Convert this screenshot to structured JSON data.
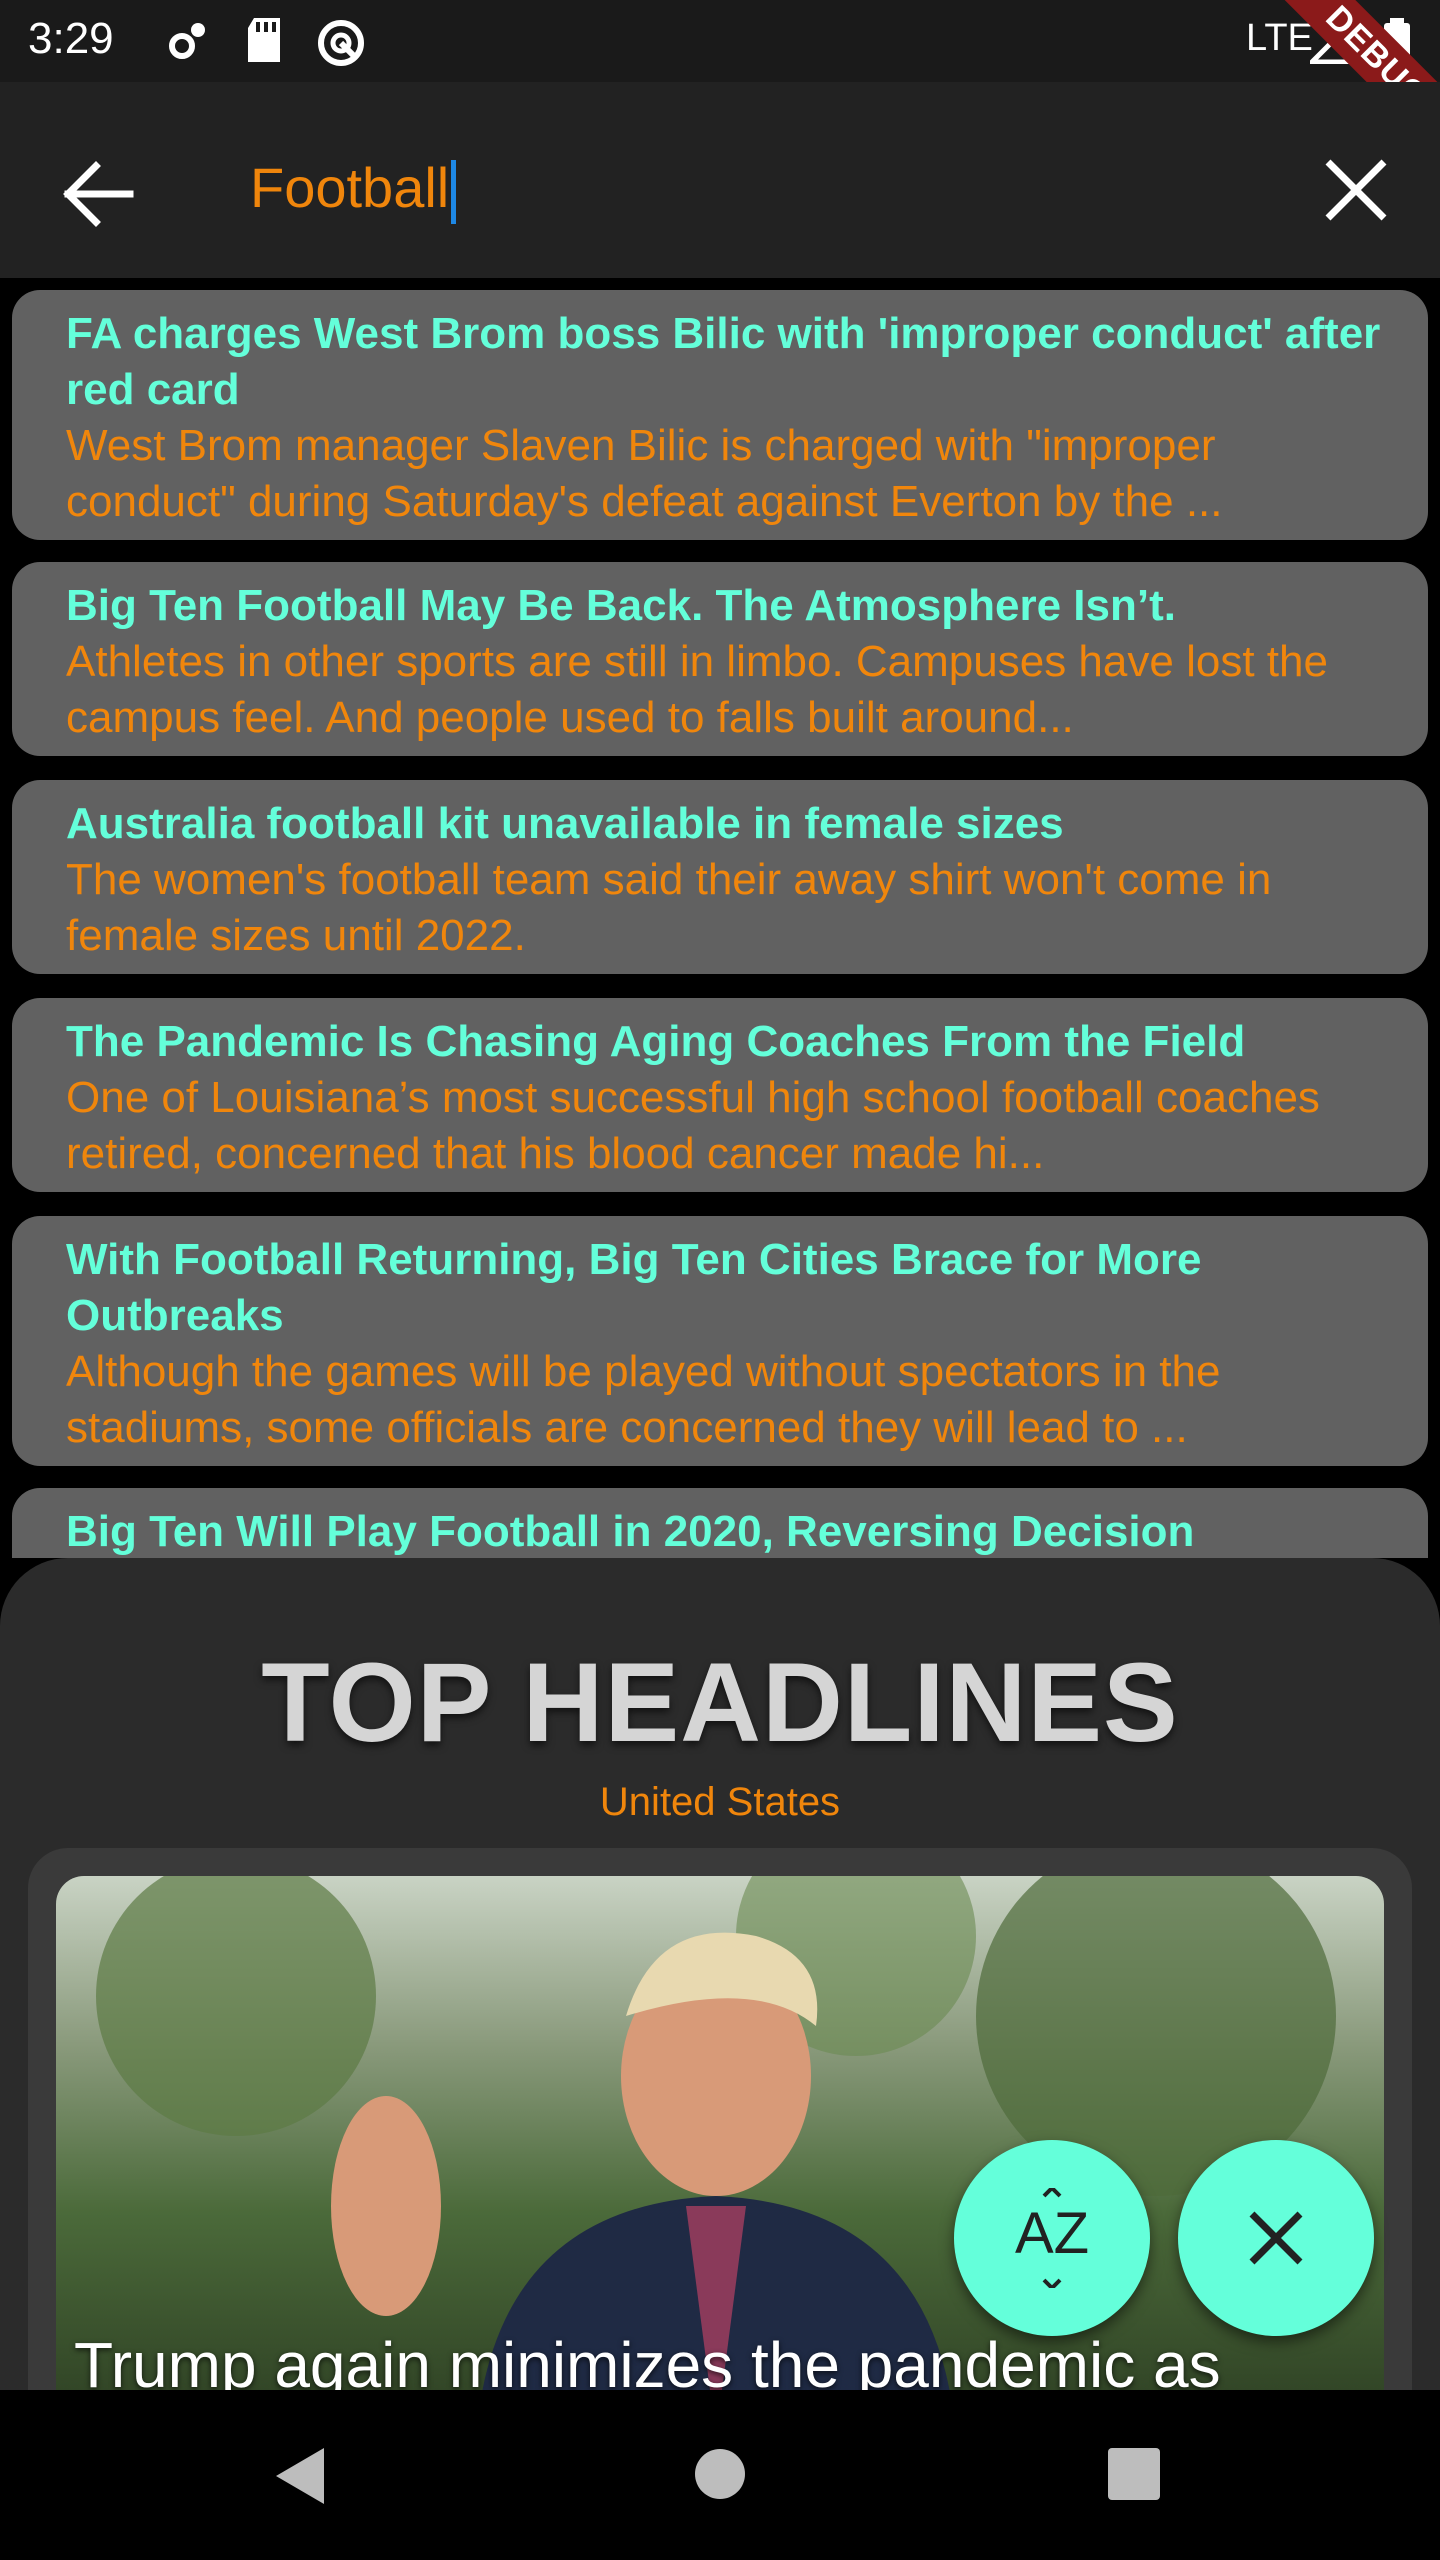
{
  "status_bar": {
    "time": "3:29",
    "network": "LTE",
    "debug_label": "DEBUG"
  },
  "search": {
    "query": "Football"
  },
  "results": [
    {
      "title": "FA charges West Brom boss Bilic with 'improper conduct' after red card",
      "description": "West Brom manager Slaven Bilic is charged with \"improper conduct\" during Saturday's defeat against Everton by the ..."
    },
    {
      "title": "Big Ten Football May Be Back. The Atmosphere Isn’t.",
      "description": "Athletes in other sports are still in limbo. Campuses have lost the campus feel. And people used to falls built around..."
    },
    {
      "title": "Australia football kit unavailable in female sizes",
      "description": "The women's football team said their away shirt won't come in female sizes until 2022."
    },
    {
      "title": "The Pandemic Is Chasing Aging Coaches From the Field",
      "description": "One of Louisiana’s most successful high school football coaches retired, concerned that his blood cancer made hi..."
    },
    {
      "title": "With Football Returning, Big Ten Cities Brace for More Outbreaks",
      "description": "Although the games will be played without spectators in the stadiums, some officials are concerned they will lead to ..."
    },
    {
      "title": "Big Ten Will Play Football in 2020, Reversing Decision",
      "description": ""
    }
  ],
  "top_headlines": {
    "title": "TOP HEADLINES",
    "country": "United States",
    "headline": "Trump again minimizes the pandemic as"
  },
  "fabs": {
    "sort_label": "AZ"
  },
  "colors": {
    "accent": "#64ffda",
    "orange": "#f0860c",
    "card": "#616161"
  }
}
